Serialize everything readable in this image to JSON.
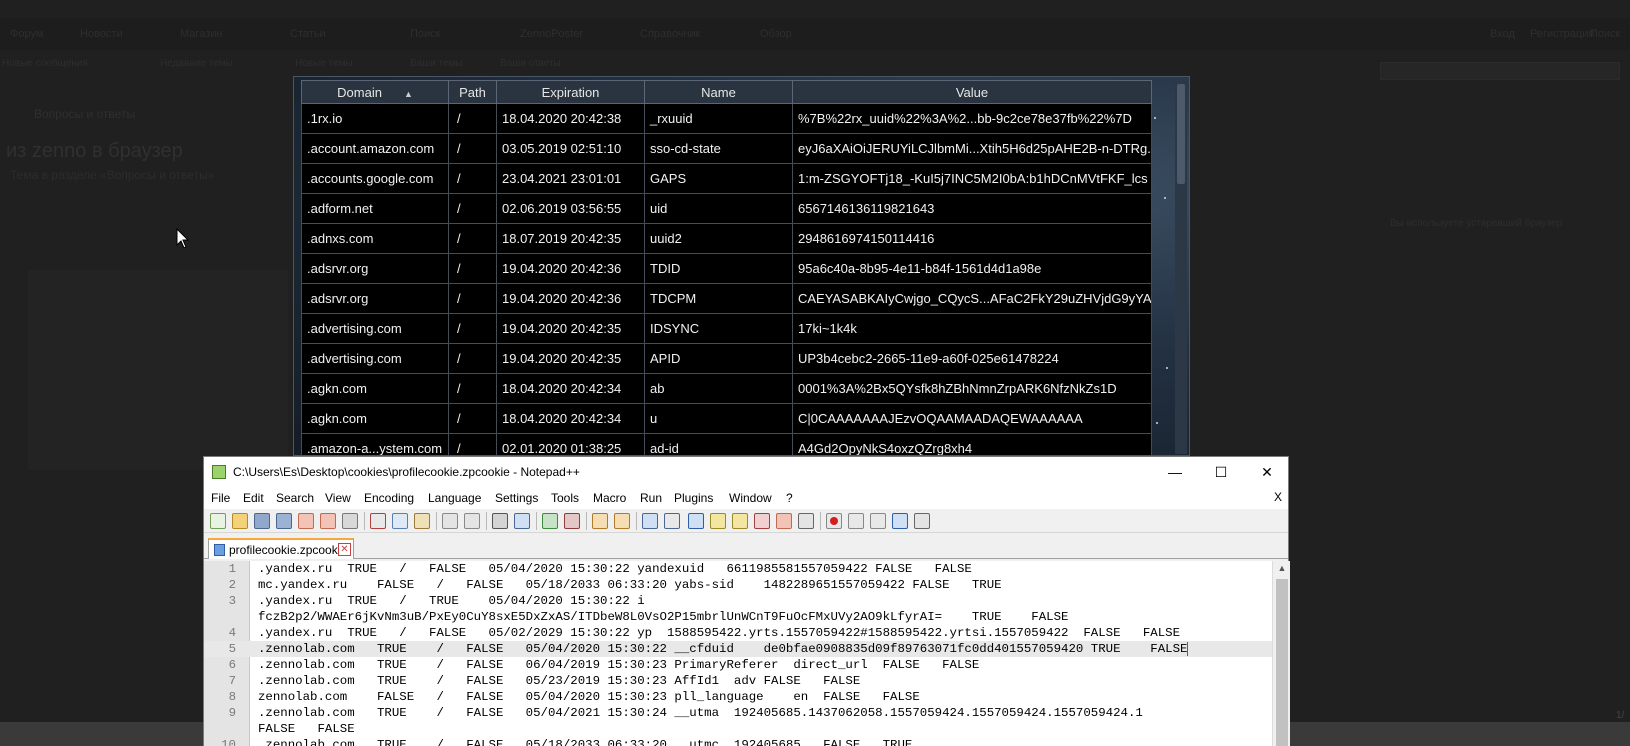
{
  "background": {
    "nav_items": [
      "Форум",
      "Новости",
      "Магазин",
      "Статьи",
      "Поиск",
      "ZennoPoster",
      "Справочник",
      "Обзор"
    ],
    "subnav_items": [
      "Новые сообщения",
      "Недавние темы",
      "Новые темы",
      "Ваши темы",
      "Ваши ответы"
    ],
    "header_links": [
      "Вход",
      "Регистрация",
      "Поиск"
    ],
    "crumb": "Вопросы и ответы",
    "heading": "из zenno в браузер",
    "subheading": "Тема в разделе «Вопросы и ответы»",
    "side_text": "Вы используете устаревший браузер",
    "page_num": "1/"
  },
  "cookie_viewer": {
    "columns": [
      {
        "key": "domain",
        "label": "Domain",
        "sort": "asc"
      },
      {
        "key": "path",
        "label": "Path"
      },
      {
        "key": "expiration",
        "label": "Expiration"
      },
      {
        "key": "name",
        "label": "Name"
      },
      {
        "key": "value",
        "label": "Value"
      }
    ],
    "rows": [
      {
        "domain": ".1rx.io",
        "path": "/",
        "expiration": "18.04.2020 20:42:38",
        "name": "_rxuuid",
        "value": "%7B%22rx_uuid%22%3A%2...bb-9c2ce78e37fb%22%7D"
      },
      {
        "domain": ".account.amazon.com",
        "path": "/",
        "expiration": "03.05.2019 02:51:10",
        "name": "sso-cd-state",
        "value": "eyJ6aXAiOiJERUYiLCJlbmMi...Xtih5H6d25pAHE2B-n-DTRg."
      },
      {
        "domain": ".accounts.google.com",
        "path": "/",
        "expiration": "23.04.2021 23:01:01",
        "name": "GAPS",
        "value": "1:m-ZSGYOFTj18_-KuI5j7INC5M2I0bA:b1hDCnMVtFKF_lcs"
      },
      {
        "domain": ".adform.net",
        "path": "/",
        "expiration": "02.06.2019 03:56:55",
        "name": "uid",
        "value": "6567146136119821643"
      },
      {
        "domain": ".adnxs.com",
        "path": "/",
        "expiration": "18.07.2019 20:42:35",
        "name": "uuid2",
        "value": "2948616974150114416"
      },
      {
        "domain": ".adsrvr.org",
        "path": "/",
        "expiration": "19.04.2020 20:42:36",
        "name": "TDID",
        "value": "95a6c40a-8b95-4e11-b84f-1561d4d1a98e"
      },
      {
        "domain": ".adsrvr.org",
        "path": "/",
        "expiration": "19.04.2020 20:42:36",
        "name": "TDCPM",
        "value": "CAEYASABKAIyCwjgo_CQycS...AFaC2FkY29uZHVjdG9yYAI."
      },
      {
        "domain": ".advertising.com",
        "path": "/",
        "expiration": "19.04.2020 20:42:35",
        "name": "IDSYNC",
        "value": "17ki~1k4k"
      },
      {
        "domain": ".advertising.com",
        "path": "/",
        "expiration": "19.04.2020 20:42:35",
        "name": "APID",
        "value": "UP3b4cebc2-2665-11e9-a60f-025e61478224"
      },
      {
        "domain": ".agkn.com",
        "path": "/",
        "expiration": "18.04.2020 20:42:34",
        "name": "ab",
        "value": "0001%3A%2Bx5QYsfk8hZBhNmnZrpARK6NfzNkZs1D"
      },
      {
        "domain": ".agkn.com",
        "path": "/",
        "expiration": "18.04.2020 20:42:34",
        "name": "u",
        "value": "C|0CAAAAAAAJEzvOQAAMAADAQEWAAAAAA"
      },
      {
        "domain": ".amazon-a...ystem.com",
        "path": "/",
        "expiration": "02.01.2020 01:38:25",
        "name": "ad-id",
        "value": "A4Gd2OpyNkS4oxzQZrg8xh4"
      }
    ]
  },
  "notepad": {
    "title": "C:\\Users\\Es\\Desktop\\cookies\\profilecookie.zpcookie - Notepad++",
    "window_buttons": {
      "minimize": "—",
      "maximize": "☐",
      "close": "✕"
    },
    "menu": [
      "File",
      "Edit",
      "Search",
      "View",
      "Encoding",
      "Language",
      "Settings",
      "Tools",
      "Macro",
      "Run",
      "Plugins",
      "Window",
      "?"
    ],
    "menu_close": "X",
    "tab_label": "profilecookie.zpcookie",
    "tab_close": "✕",
    "lines": [
      {
        "num": "1",
        "text": ".yandex.ru  TRUE   /   FALSE   05/04/2020 15:30:22 yandexuid   6611985581557059422 FALSE   FALSE"
      },
      {
        "num": "2",
        "text": "mc.yandex.ru    FALSE   /   FALSE   05/18/2033 06:33:20 yabs-sid    1482289651557059422 FALSE   TRUE"
      },
      {
        "num": "3",
        "text": ".yandex.ru  TRUE   /   TRUE    05/04/2020 15:30:22 i"
      },
      {
        "num": "",
        "text": "fczB2p2/WWAEr6jKvNm3uB/PxEy0CuY8sxE5DxZxAS/ITDbeW8L0VsO2P15mbrlUnWCnT9FuOcFMxUVy2AO9kLfyrAI=    TRUE    FALSE"
      },
      {
        "num": "4",
        "text": ".yandex.ru  TRUE   /   FALSE   05/02/2029 15:30:22 yp  1588595422.yrts.1557059422#1588595422.yrtsi.1557059422  FALSE   FALSE"
      },
      {
        "num": "5",
        "text": ".zennolab.com   TRUE    /   FALSE   05/04/2020 15:30:22 __cfduid    de0bfae0908835d09f89763071fc0dd401557059420 TRUE    FALSE",
        "highlight": true
      },
      {
        "num": "6",
        "text": ".zennolab.com   TRUE    /   FALSE   06/04/2019 15:30:23 PrimaryReferer  direct_url  FALSE   FALSE"
      },
      {
        "num": "7",
        "text": ".zennolab.com   TRUE    /   FALSE   05/23/2019 15:30:23 AffId1  adv FALSE   FALSE"
      },
      {
        "num": "8",
        "text": "zennolab.com    FALSE   /   FALSE   05/04/2020 15:30:23 pll_language    en  FALSE   FALSE"
      },
      {
        "num": "9",
        "text": ".zennolab.com   TRUE    /   FALSE   05/04/2021 15:30:24 __utma  192405685.1437062058.1557059424.1557059424.1557059424.1"
      },
      {
        "num": "",
        "text": "FALSE   FALSE"
      },
      {
        "num": "10",
        "text": ".zennolab.com   TRUE    /   FALSE   05/18/2033 06:33:20 __utmc  192405685   FALSE   TRUE"
      }
    ]
  }
}
